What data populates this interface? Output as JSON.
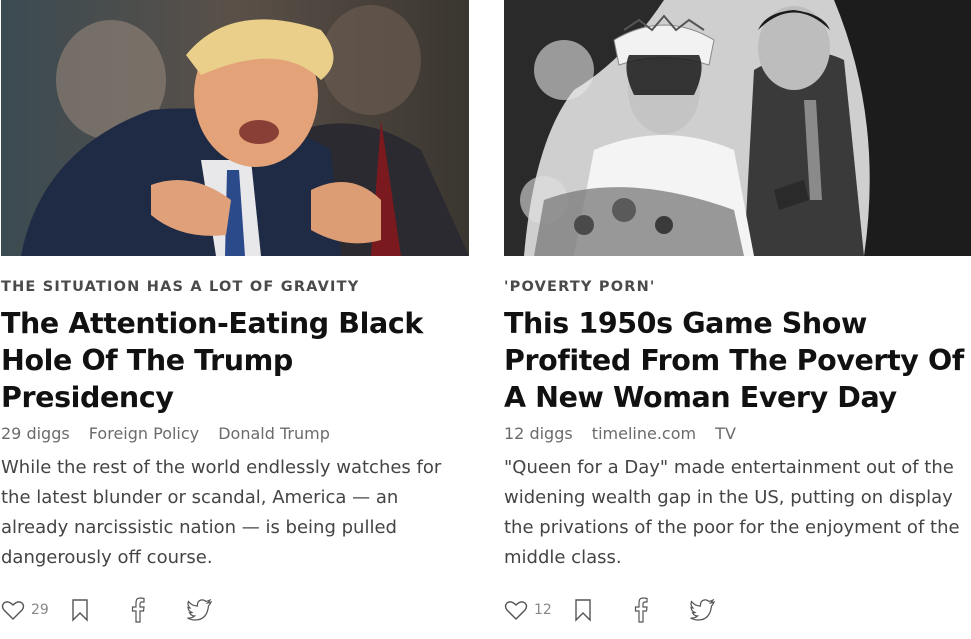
{
  "cards": [
    {
      "kicker": "THE SITUATION HAS A LOT OF GRAVITY",
      "headline": "The Attention-Eating Black Hole Of The Trump Presidency",
      "diggs": "29 diggs",
      "source": "Foreign Policy",
      "tag": "Donald Trump",
      "description": "While the rest of the world endlessly watches for the latest blunder or scandal, America — an already narcissistic nation — is being pulled dangerously off course.",
      "like_count": "29",
      "icons": [
        "heart-icon",
        "bookmark-icon",
        "facebook-icon",
        "twitter-icon"
      ]
    },
    {
      "kicker": "'POVERTY PORN'",
      "headline": "This 1950s Game Show Profited From The Poverty Of A New Woman Every Day",
      "diggs": "12 diggs",
      "source": "timeline.com",
      "tag": "TV",
      "description": "\"Queen for a Day\" made entertainment out of the widening wealth gap in the US, putting on display the privations of the poor for the enjoyment of the middle class.",
      "like_count": "12",
      "icons": [
        "heart-icon",
        "bookmark-icon",
        "facebook-icon",
        "twitter-icon"
      ]
    }
  ]
}
